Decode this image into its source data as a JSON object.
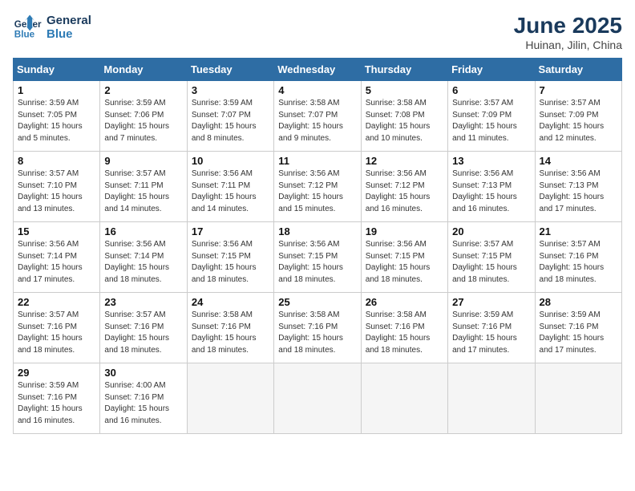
{
  "logo": {
    "line1": "General",
    "line2": "Blue"
  },
  "title": "June 2025",
  "subtitle": "Huinan, Jilin, China",
  "days_of_week": [
    "Sunday",
    "Monday",
    "Tuesday",
    "Wednesday",
    "Thursday",
    "Friday",
    "Saturday"
  ],
  "weeks": [
    [
      {
        "day": "1",
        "sunrise": "3:59 AM",
        "sunset": "7:05 PM",
        "daylight": "15 hours and 5 minutes."
      },
      {
        "day": "2",
        "sunrise": "3:59 AM",
        "sunset": "7:06 PM",
        "daylight": "15 hours and 7 minutes."
      },
      {
        "day": "3",
        "sunrise": "3:59 AM",
        "sunset": "7:07 PM",
        "daylight": "15 hours and 8 minutes."
      },
      {
        "day": "4",
        "sunrise": "3:58 AM",
        "sunset": "7:07 PM",
        "daylight": "15 hours and 9 minutes."
      },
      {
        "day": "5",
        "sunrise": "3:58 AM",
        "sunset": "7:08 PM",
        "daylight": "15 hours and 10 minutes."
      },
      {
        "day": "6",
        "sunrise": "3:57 AM",
        "sunset": "7:09 PM",
        "daylight": "15 hours and 11 minutes."
      },
      {
        "day": "7",
        "sunrise": "3:57 AM",
        "sunset": "7:09 PM",
        "daylight": "15 hours and 12 minutes."
      }
    ],
    [
      {
        "day": "8",
        "sunrise": "3:57 AM",
        "sunset": "7:10 PM",
        "daylight": "15 hours and 13 minutes."
      },
      {
        "day": "9",
        "sunrise": "3:57 AM",
        "sunset": "7:11 PM",
        "daylight": "15 hours and 14 minutes."
      },
      {
        "day": "10",
        "sunrise": "3:56 AM",
        "sunset": "7:11 PM",
        "daylight": "15 hours and 14 minutes."
      },
      {
        "day": "11",
        "sunrise": "3:56 AM",
        "sunset": "7:12 PM",
        "daylight": "15 hours and 15 minutes."
      },
      {
        "day": "12",
        "sunrise": "3:56 AM",
        "sunset": "7:12 PM",
        "daylight": "15 hours and 16 minutes."
      },
      {
        "day": "13",
        "sunrise": "3:56 AM",
        "sunset": "7:13 PM",
        "daylight": "15 hours and 16 minutes."
      },
      {
        "day": "14",
        "sunrise": "3:56 AM",
        "sunset": "7:13 PM",
        "daylight": "15 hours and 17 minutes."
      }
    ],
    [
      {
        "day": "15",
        "sunrise": "3:56 AM",
        "sunset": "7:14 PM",
        "daylight": "15 hours and 17 minutes."
      },
      {
        "day": "16",
        "sunrise": "3:56 AM",
        "sunset": "7:14 PM",
        "daylight": "15 hours and 18 minutes."
      },
      {
        "day": "17",
        "sunrise": "3:56 AM",
        "sunset": "7:15 PM",
        "daylight": "15 hours and 18 minutes."
      },
      {
        "day": "18",
        "sunrise": "3:56 AM",
        "sunset": "7:15 PM",
        "daylight": "15 hours and 18 minutes."
      },
      {
        "day": "19",
        "sunrise": "3:56 AM",
        "sunset": "7:15 PM",
        "daylight": "15 hours and 18 minutes."
      },
      {
        "day": "20",
        "sunrise": "3:57 AM",
        "sunset": "7:15 PM",
        "daylight": "15 hours and 18 minutes."
      },
      {
        "day": "21",
        "sunrise": "3:57 AM",
        "sunset": "7:16 PM",
        "daylight": "15 hours and 18 minutes."
      }
    ],
    [
      {
        "day": "22",
        "sunrise": "3:57 AM",
        "sunset": "7:16 PM",
        "daylight": "15 hours and 18 minutes."
      },
      {
        "day": "23",
        "sunrise": "3:57 AM",
        "sunset": "7:16 PM",
        "daylight": "15 hours and 18 minutes."
      },
      {
        "day": "24",
        "sunrise": "3:58 AM",
        "sunset": "7:16 PM",
        "daylight": "15 hours and 18 minutes."
      },
      {
        "day": "25",
        "sunrise": "3:58 AM",
        "sunset": "7:16 PM",
        "daylight": "15 hours and 18 minutes."
      },
      {
        "day": "26",
        "sunrise": "3:58 AM",
        "sunset": "7:16 PM",
        "daylight": "15 hours and 18 minutes."
      },
      {
        "day": "27",
        "sunrise": "3:59 AM",
        "sunset": "7:16 PM",
        "daylight": "15 hours and 17 minutes."
      },
      {
        "day": "28",
        "sunrise": "3:59 AM",
        "sunset": "7:16 PM",
        "daylight": "15 hours and 17 minutes."
      }
    ],
    [
      {
        "day": "29",
        "sunrise": "3:59 AM",
        "sunset": "7:16 PM",
        "daylight": "15 hours and 16 minutes."
      },
      {
        "day": "30",
        "sunrise": "4:00 AM",
        "sunset": "7:16 PM",
        "daylight": "15 hours and 16 minutes."
      },
      null,
      null,
      null,
      null,
      null
    ]
  ]
}
